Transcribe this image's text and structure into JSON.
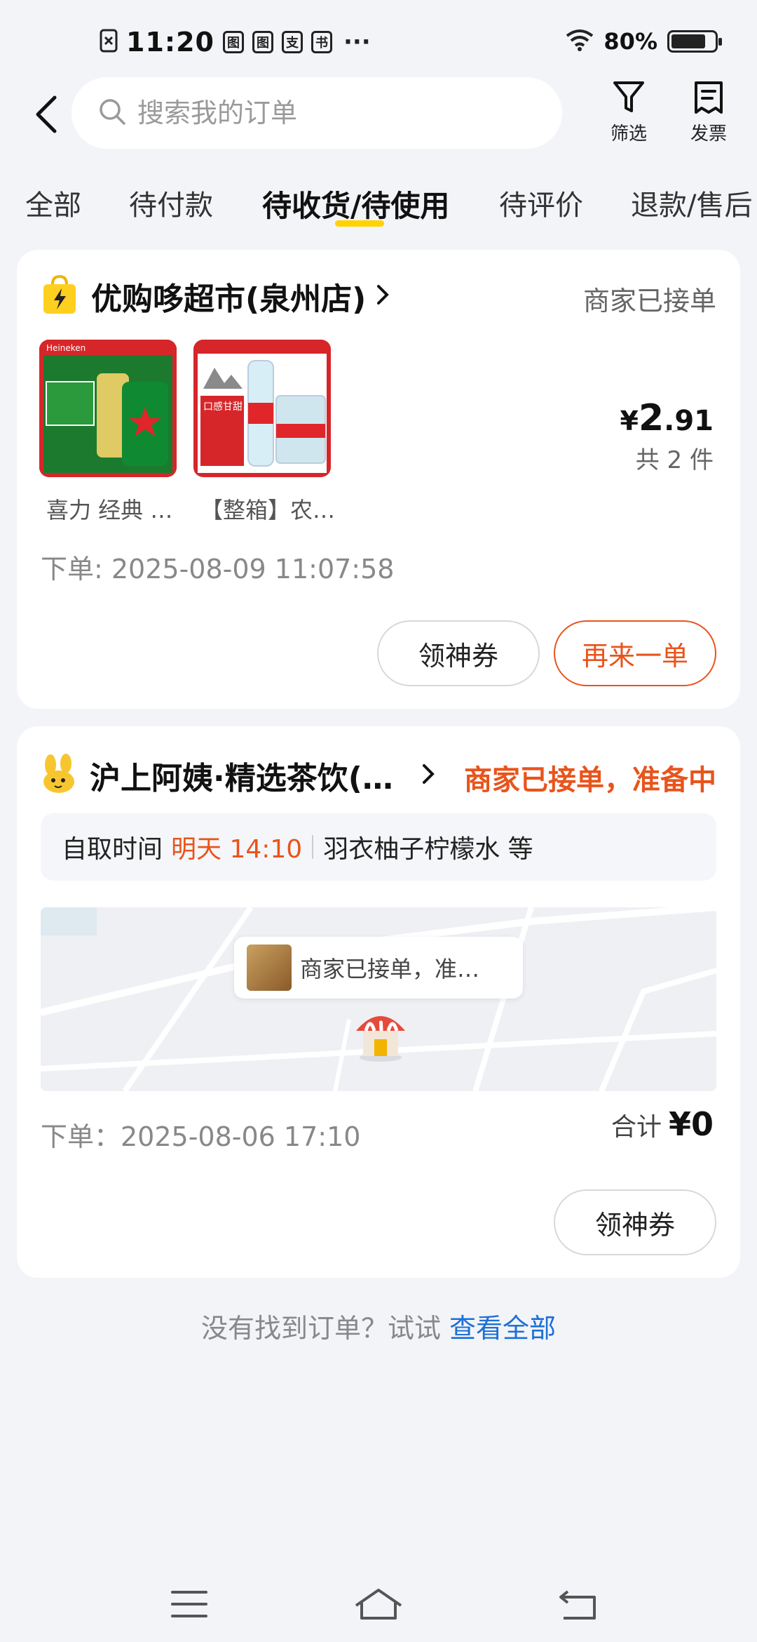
{
  "status_bar": {
    "time": "11:20",
    "notif_icons": [
      "图",
      "图",
      "支",
      "书"
    ],
    "more": "···",
    "battery": "80%",
    "battery_level": 0.8
  },
  "header": {
    "search_placeholder": "搜索我的订单",
    "filter_label": "筛选",
    "invoice_label": "发票"
  },
  "tabs": [
    {
      "label": "全部"
    },
    {
      "label": "待付款"
    },
    {
      "label": "待收货/待使用",
      "active": true
    },
    {
      "label": "待评价"
    },
    {
      "label": "退款/售后"
    }
  ],
  "orders": [
    {
      "store": "优购哆超市(泉州店)",
      "status": "商家已接单",
      "items": [
        {
          "caption": "喜力 经典 …",
          "img_text": "Heineken"
        },
        {
          "caption": "【整箱】农…",
          "img_text": "口感甘甜"
        }
      ],
      "price_currency": "¥",
      "price_int": "2",
      "price_dec": ".91",
      "count": "共 2 件",
      "order_time": "下单: 2025-08-09 11:07:58",
      "buttons": {
        "coupon": "领神券",
        "reorder": "再来一单"
      }
    },
    {
      "store": "沪上阿姨·精选茶饮(…",
      "status": "商家已接单，准备中",
      "pickup_label": "自取时间",
      "pickup_time": "明天 14:10",
      "pickup_items": "羽衣柚子柠檬水 等",
      "map_bubble": "商家已接单，准…",
      "order_time": "下单：2025-08-06 17:10",
      "total_label": "合计",
      "total_value": "¥0",
      "buttons": {
        "coupon": "领神券"
      }
    }
  ],
  "footer": {
    "not_found": "没有找到订单？试试",
    "view_all": "查看全部"
  },
  "colors": {
    "accent_orange": "#e8541c",
    "tab_indicator": "#ffd200",
    "link_blue": "#1d6fd6",
    "bg": "#f3f4f8"
  }
}
